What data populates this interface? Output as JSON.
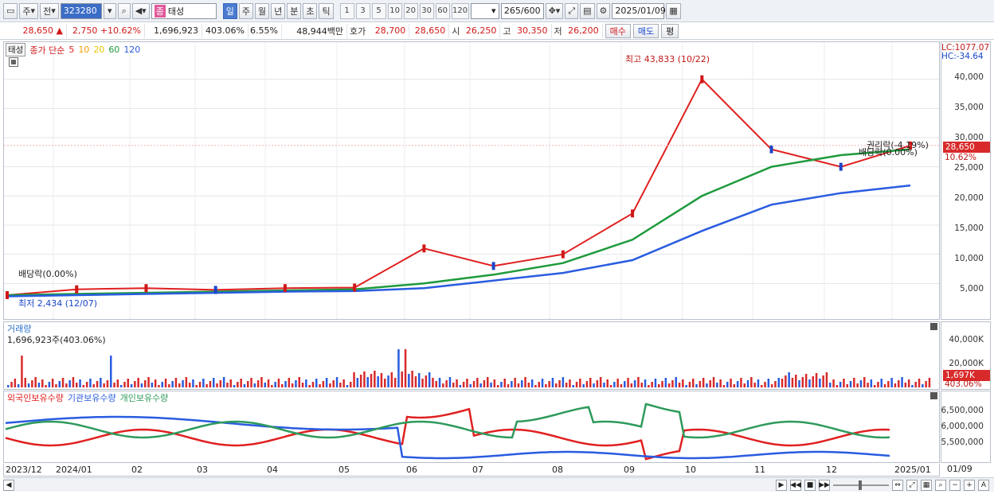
{
  "toolbar": {
    "period_label": "주",
    "prev_label": "전",
    "stock_code": "323280",
    "stock_name": "태성",
    "stock_tag": "종",
    "timeframes": [
      "일",
      "주",
      "월",
      "년",
      "분",
      "초",
      "틱"
    ],
    "active_timeframe": "일",
    "intervals": [
      "1",
      "3",
      "5",
      "10",
      "20",
      "30",
      "60",
      "120"
    ],
    "count": "265",
    "count_max": "/600",
    "date": "2025/01/09"
  },
  "quote": {
    "price": "28,650",
    "arrow": "▲",
    "change": "2,750",
    "change_pct": "+10.62%",
    "volume": "1,696,923",
    "volume_ratio": "403.06%",
    "turnover": "6.55%",
    "amount": "48,944백만",
    "ask_label": "호가",
    "ask": "28,700",
    "bid": "28,650",
    "open_label": "시",
    "open": "26,250",
    "high_label": "고",
    "high": "30,350",
    "low_label": "저",
    "low": "26,200",
    "buy_label": "매수",
    "sell_label": "매도",
    "eval_label": "평"
  },
  "price_panel": {
    "name_box": "태성",
    "ma_title": "종가 단순",
    "ma_periods": [
      {
        "label": "5",
        "color": "#e02020"
      },
      {
        "label": "10",
        "color": "#f0a000"
      },
      {
        "label": "20",
        "color": "#f0d800"
      },
      {
        "label": "60",
        "color": "#1e9a3c"
      },
      {
        "label": "120",
        "color": "#2a5ce0"
      }
    ],
    "high_note": "최고 43,833 (10/22)",
    "low_note": "최저 2,434 (12/07)",
    "dividend_note": "배당락(0.00%)",
    "rights_note": "권리락(-4.19%)",
    "dividend_note2": "배당락(0.00%)",
    "lc": "LC:1077.07",
    "hc": "HC:-34.64",
    "y_ticks": [
      "40,000",
      "35,000",
      "30,000",
      "25,000",
      "20,000",
      "15,000",
      "10,000",
      "5,000"
    ],
    "last_price_tag": "28,650",
    "last_pct_tag": "10.62%"
  },
  "volume_panel": {
    "title": "거래량",
    "sub": "1,696,923주(403.06%)",
    "y_ticks": [
      "40,000K",
      "20,000K"
    ],
    "last_tag": "1,697K",
    "last_pct": "403.06%"
  },
  "own_panel": {
    "series": [
      {
        "label": "외국인보유수량",
        "color": "#e02020"
      },
      {
        "label": "기관보유수량",
        "color": "#2a5ce0"
      },
      {
        "label": "개인보유수량",
        "color": "#2e9a5c"
      }
    ],
    "y_ticks": [
      "6,500,000",
      "6,000,000",
      "5,500,000"
    ]
  },
  "x_axis": {
    "labels": [
      "2023/12",
      "2024/01",
      "02",
      "03",
      "04",
      "05",
      "06",
      "07",
      "08",
      "09",
      "10",
      "11",
      "12",
      "2025/01"
    ],
    "right_label": "01/09"
  },
  "colors": {
    "up": "#d01818",
    "down": "#1a46c8",
    "ma5": "#e02020",
    "ma10": "#f0a000",
    "ma20": "#f0d800",
    "ma60": "#1e9a3c",
    "ma120": "#2a5ce0"
  },
  "chart_data": {
    "type": "line",
    "title": "",
    "x": [
      "2023/12",
      "2024/01",
      "02",
      "03",
      "04",
      "05",
      "06",
      "07",
      "08",
      "09",
      "10",
      "11",
      "12",
      "2025/01"
    ],
    "series": [
      {
        "name": "5",
        "values": [
          3000,
          4000,
          4200,
          3900,
          4200,
          4300,
          11000,
          8000,
          10000,
          17000,
          40000,
          28000,
          25000,
          28650
        ]
      },
      {
        "name": "60",
        "values": [
          3000,
          3200,
          3400,
          3600,
          3800,
          4000,
          5000,
          6500,
          8500,
          12500,
          20000,
          25000,
          27000,
          28000
        ]
      },
      {
        "name": "120",
        "values": [
          2800,
          3000,
          3200,
          3400,
          3600,
          3700,
          4200,
          5500,
          6800,
          9000,
          14000,
          18500,
          20500,
          21800
        ]
      }
    ],
    "ylabel": "",
    "ylim": [
      0,
      45000
    ]
  }
}
